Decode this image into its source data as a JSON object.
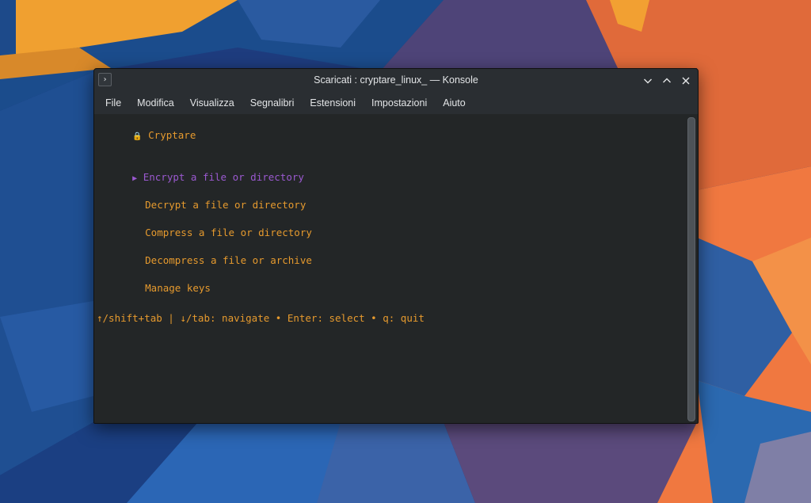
{
  "window": {
    "title": "Scaricati : cryptare_linux_ — Konsole",
    "app_icon_glyph": "›"
  },
  "menubar": {
    "items": [
      "File",
      "Modifica",
      "Visualizza",
      "Segnalibri",
      "Estensioni",
      "Impostazioni",
      "Aiuto"
    ]
  },
  "terminal": {
    "header_icon": "🔒",
    "header_title": "Cryptare",
    "selection_marker": "▶",
    "options": [
      {
        "label": "Encrypt a file or directory",
        "selected": true
      },
      {
        "label": "Decrypt a file or directory",
        "selected": false
      },
      {
        "label": "Compress a file or directory",
        "selected": false
      },
      {
        "label": "Decompress a file or archive",
        "selected": false
      },
      {
        "label": "Manage keys",
        "selected": false
      }
    ],
    "help_text": "↑/shift+tab | ↓/tab: navigate • Enter: select • q: quit"
  },
  "colors": {
    "accent_orange": "#e69a2e",
    "selected_purple": "#9b59d0",
    "terminal_bg": "#232627",
    "titlebar_bg": "#2a2e32"
  }
}
